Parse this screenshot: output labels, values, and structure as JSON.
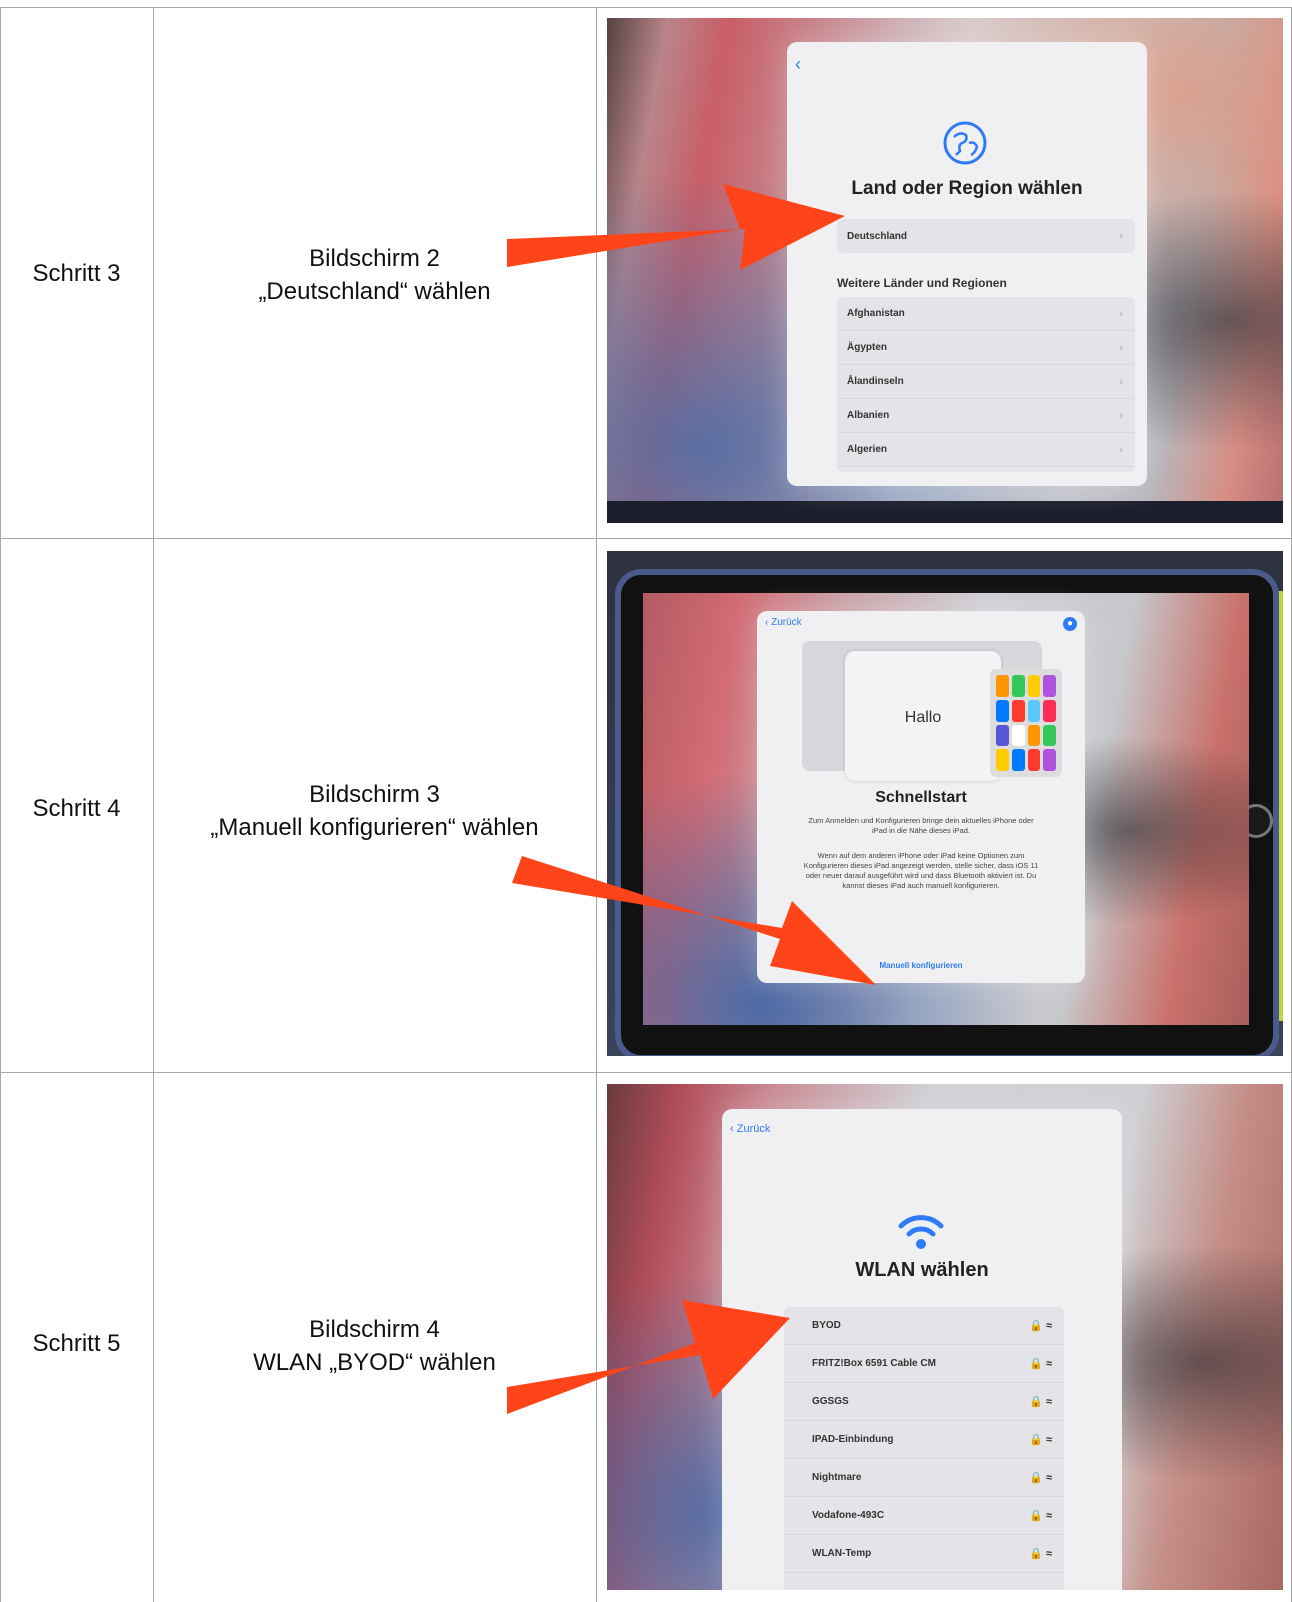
{
  "rows": [
    {
      "step": "Schritt 3",
      "desc_line1": "Bildschirm 2",
      "desc_line2": "„Deutschland“ wählen",
      "screen": {
        "back_icon": "chevron-left-icon",
        "globe_icon": "globe-icon",
        "title": "Land oder Region wählen",
        "selected": "Deutschland",
        "section": "Weitere Länder und Regionen",
        "items": [
          "Afghanistan",
          "Ägypten",
          "Ålandinseln",
          "Albanien",
          "Algerien"
        ]
      }
    },
    {
      "step": "Schritt 4",
      "desc_line1": "Bildschirm 3",
      "desc_line2": "„Manuell konfigurieren“ wählen",
      "screen": {
        "back_label": "Zurück",
        "hello": "Hallo",
        "title": "Schnellstart",
        "para1": "Zum Anmelden und Konfigurieren bringe dein aktuelles iPhone oder iPad in die Nähe dieses iPad.",
        "para2": "Wenn auf dem anderen iPhone oder iPad keine Optionen zum Konfigurieren dieses iPad angezeigt werden, stelle sicher, dass iOS 11 oder neuer darauf ausgeführt wird und dass Bluetooth aktiviert ist. Du kannst dieses iPad auch manuell konfigurieren.",
        "manual_link": "Manuell konfigurieren"
      }
    },
    {
      "step": "Schritt 5",
      "desc_line1": "Bildschirm 4",
      "desc_line2": "WLAN „BYOD“ wählen",
      "screen": {
        "back_label": "Zurück",
        "wifi_icon": "wifi-icon",
        "title": "WLAN wählen",
        "networks": [
          "BYOD",
          "FRITZ!Box 6591 Cable CM",
          "GGSGS",
          "IPAD-Einbindung",
          "Nightmare",
          "Vodafone-493C",
          "WLAN-Temp"
        ]
      }
    }
  ],
  "colors": {
    "arrow": "#ff4419",
    "ios_blue": "#2f7bf6",
    "grid": "#a9a9a9"
  }
}
